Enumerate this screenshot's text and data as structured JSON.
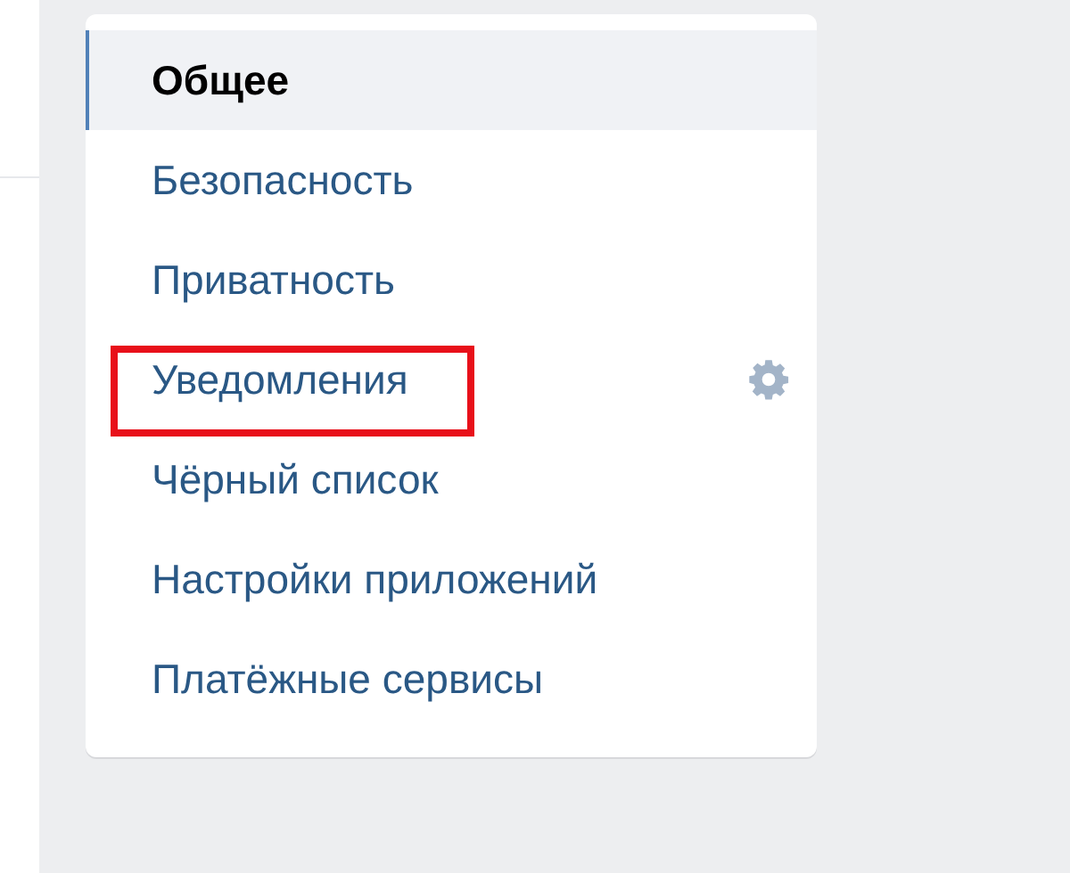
{
  "menu": {
    "items": [
      {
        "label": "Общее",
        "selected": true,
        "highlighted": false,
        "settings_icon": false
      },
      {
        "label": "Безопасность",
        "selected": false,
        "highlighted": false,
        "settings_icon": false
      },
      {
        "label": "Приватность",
        "selected": false,
        "highlighted": false,
        "settings_icon": false
      },
      {
        "label": "Уведомления",
        "selected": false,
        "highlighted": true,
        "settings_icon": true
      },
      {
        "label": "Чёрный список",
        "selected": false,
        "highlighted": false,
        "settings_icon": false
      },
      {
        "label": "Настройки приложений",
        "selected": false,
        "highlighted": false,
        "settings_icon": false
      },
      {
        "label": "Платёжные сервисы",
        "selected": false,
        "highlighted": false,
        "settings_icon": false
      }
    ]
  }
}
